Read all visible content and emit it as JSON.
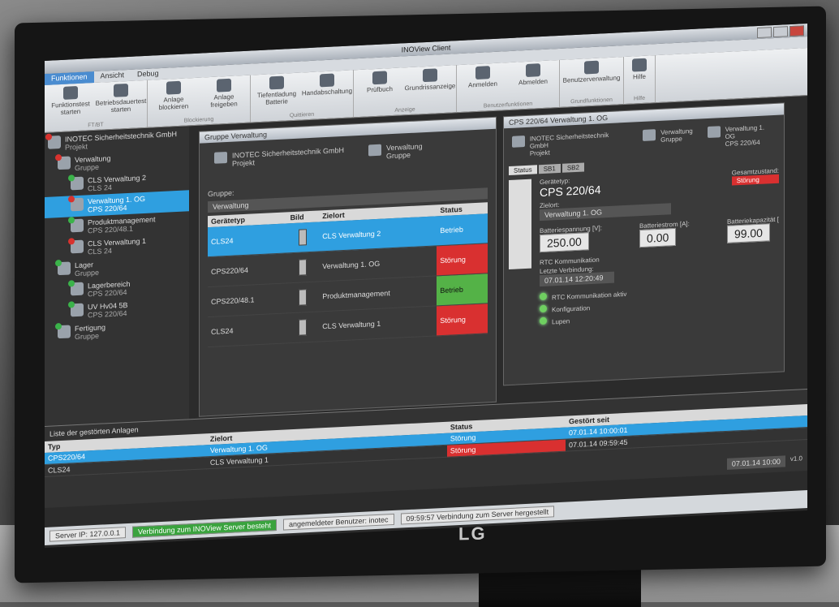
{
  "app": {
    "title": "INOView Client"
  },
  "ribbon": {
    "tabs": [
      "Funktionen",
      "Ansicht",
      "Debug"
    ],
    "groups": [
      {
        "label": "FT/BT",
        "buttons": [
          "Funktionstest starten",
          "Betriebsdauertest starten"
        ]
      },
      {
        "label": "Blockierung",
        "buttons": [
          "Anlage blockieren",
          "Anlage freigeben"
        ]
      },
      {
        "label": "Quittieren",
        "buttons": [
          "Tiefentladung Batterie",
          "Handabschaltung"
        ]
      },
      {
        "label": "Anzeige",
        "buttons": [
          "Prüfbuch",
          "Grundrissanzeige"
        ]
      },
      {
        "label": "Benutzerfunktionen",
        "buttons": [
          "Anmelden",
          "Abmelden"
        ]
      },
      {
        "label": "Grundfunktionen",
        "buttons": [
          "Benutzerverwaltung"
        ]
      },
      {
        "label": "Hilfe",
        "buttons": [
          "Hilfe"
        ]
      }
    ]
  },
  "tree": [
    {
      "name": "INOTEC Sicherheitstechnik GmbH",
      "sub": "Projekt",
      "status": "red"
    },
    {
      "name": "Verwaltung",
      "sub": "Gruppe",
      "status": "red"
    },
    {
      "name": "CLS Verwaltung 2",
      "sub": "CLS 24",
      "status": "green"
    },
    {
      "name": "Verwaltung 1. OG",
      "sub": "CPS 220/64",
      "status": "red",
      "selected": true
    },
    {
      "name": "Produktmanagement",
      "sub": "CPS 220/48.1",
      "status": "green"
    },
    {
      "name": "CLS Verwaltung 1",
      "sub": "CLS 24",
      "status": "red"
    },
    {
      "name": "Lager",
      "sub": "Gruppe",
      "status": "green"
    },
    {
      "name": "Lagerbereich",
      "sub": "CPS 220/64",
      "status": "green"
    },
    {
      "name": "UV Hv04 5B",
      "sub": "CPS 220/64",
      "status": "green"
    },
    {
      "name": "Fertigung",
      "sub": "Gruppe",
      "status": "green"
    }
  ],
  "group_panel": {
    "title": "Gruppe Verwaltung",
    "crumb1": {
      "name": "INOTEC Sicherheitstechnik GmbH",
      "sub": "Projekt"
    },
    "crumb2": {
      "name": "Verwaltung",
      "sub": "Gruppe"
    },
    "group_label": "Gruppe:",
    "group_value": "Verwaltung",
    "columns": [
      "Gerätetyp",
      "Bild",
      "Zielort",
      "Status"
    ],
    "rows": [
      {
        "type": "CLS24",
        "target": "CLS Verwaltung 2",
        "status": "Betrieb",
        "ok": true,
        "selected": true
      },
      {
        "type": "CPS220/64",
        "target": "Verwaltung 1. OG",
        "status": "Störung",
        "ok": false
      },
      {
        "type": "CPS220/48.1",
        "target": "Produktmanagement",
        "status": "Betrieb",
        "ok": true
      },
      {
        "type": "CLS24",
        "target": "CLS Verwaltung 1",
        "status": "Störung",
        "ok": false
      }
    ]
  },
  "device_panel": {
    "title": "CPS 220/64 Verwaltung 1. OG",
    "crumb1": {
      "name": "INOTEC Sicherheitstechnik GmbH",
      "sub": "Projekt"
    },
    "crumb2": {
      "name": "Verwaltung",
      "sub": "Gruppe"
    },
    "crumb3": {
      "name": "Verwaltung 1. OG",
      "sub": "CPS 220/64"
    },
    "tabs": [
      "Status",
      "SB1",
      "SB2"
    ],
    "devtype_label": "Gerätetyp:",
    "devtype": "CPS 220/64",
    "target_label": "Zielort:",
    "target": "Verwaltung 1. OG",
    "overall_label": "Gesamtzustand:",
    "overall": "Störung",
    "batt_v_label": "Batteriespannung [V]:",
    "batt_v": "250.00",
    "batt_a_label": "Batteriestrom [A]:",
    "batt_a": "0.00",
    "batt_cap_label": "Batteriekapazität [",
    "batt_cap": "99.00",
    "rtc_label": "RTC Kommunikation",
    "last_conn_label": "Letzte Verbindung:",
    "last_conn": "07.01.14 12:20:49",
    "leds": [
      "RTC Kommunikation aktiv",
      "Konfiguration",
      "Lupen"
    ]
  },
  "bottom": {
    "title": "Liste der gestörten Anlagen",
    "columns": [
      "Typ",
      "Zielort",
      "Status",
      "Gestört seit"
    ],
    "rows": [
      {
        "type": "CPS220/64",
        "target": "Verwaltung 1. OG",
        "status": "Störung",
        "since": "07.01.14 10:00:01"
      },
      {
        "type": "CLS24",
        "target": "CLS Verwaltung 1",
        "status": "Störung",
        "since": "07.01.14 09:59:45"
      }
    ],
    "clock": "07.01.14 10:00",
    "version": "v1.0"
  },
  "statusbar": {
    "server": "Server IP: 127.0.0.1",
    "connection": "Verbindung zum INOView Server besteht",
    "user": "angemeldeter Benutzer: inotec",
    "log": "09:59:57 Verbindung zum Server hergestellt"
  },
  "monitor": {
    "brand": "LG"
  }
}
